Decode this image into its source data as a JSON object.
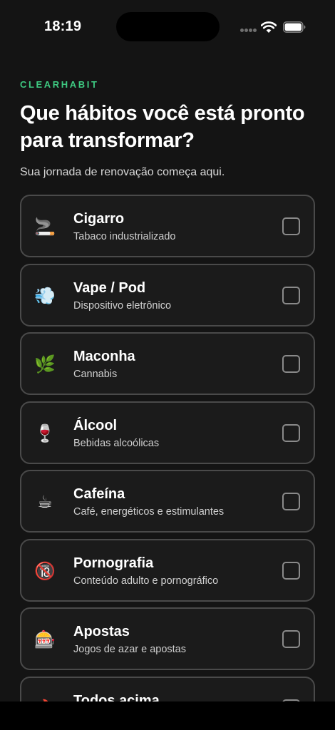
{
  "status_bar": {
    "time": "18:19"
  },
  "header": {
    "brand": "CLEARHABIT",
    "title": "Que hábitos você está pronto para transformar?",
    "subtitle": "Sua jornada de renovação começa aqui."
  },
  "habits": [
    {
      "icon": "cigarette-icon",
      "emoji": "🚬",
      "name": "Cigarro",
      "description": "Tabaco industrializado",
      "checked": false
    },
    {
      "icon": "vape-cloud-icon",
      "emoji": "💨",
      "name": "Vape / Pod",
      "description": "Dispositivo eletrônico",
      "checked": false
    },
    {
      "icon": "herb-leaf-icon",
      "emoji": "🌿",
      "name": "Maconha",
      "description": "Cannabis",
      "checked": false
    },
    {
      "icon": "wine-glass-icon",
      "emoji": "🍷",
      "name": "Álcool",
      "description": "Bebidas alcoólicas",
      "checked": false
    },
    {
      "icon": "coffee-cup-icon",
      "emoji": "☕",
      "name": "Cafeína",
      "description": "Café, energéticos e estimulantes",
      "checked": false
    },
    {
      "icon": "no-under-18-icon",
      "emoji": "🔞",
      "name": "Pornografia",
      "description": "Conteúdo adulto e pornográfico",
      "checked": false
    },
    {
      "icon": "slot-machine-icon",
      "emoji": "🎰",
      "name": "Apostas",
      "description": "Jogos de azar e apostas",
      "checked": false
    },
    {
      "icon": "fire-icon",
      "emoji": "🔥",
      "name": "Todos acima",
      "description": "",
      "checked": false
    }
  ],
  "colors": {
    "accent": "#3ec981",
    "background": "#141414",
    "card_background": "#1b1b1b",
    "card_border": "#4a4a4a"
  }
}
